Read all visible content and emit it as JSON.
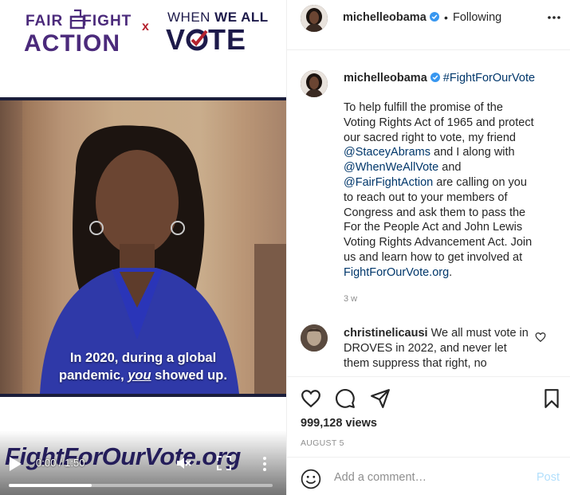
{
  "media": {
    "brand_left_line1": "FAIR",
    "brand_left_line1b": "FIGHT",
    "brand_left_line2": "ACTION",
    "brand_x": "x",
    "brand_right_line1_a": "WHEN ",
    "brand_right_line1_b": "WE ALL",
    "brand_right_line2_a": "V",
    "brand_right_line2_b": "TE",
    "subtitle_line1": "In 2020, during a global",
    "subtitle_line2_a": "pandemic, ",
    "subtitle_line2_b": "you",
    "subtitle_line2_c": " showed up.",
    "banner": "FightForOurVote.org",
    "time": "0:00 / 1:50",
    "progress": 0.315,
    "icons": [
      "play-icon",
      "mute-icon",
      "fullscreen-icon",
      "more-vertical-icon"
    ]
  },
  "header": {
    "username": "michelleobama",
    "dot": "•",
    "following": "Following"
  },
  "caption": {
    "username": "michelleobama",
    "hashtag": "#FightForOurVote",
    "lines": [
      "To help fulfill the promise of the",
      "Voting Rights Act of 1965 and protect",
      "our sacred right to vote, my friend"
    ],
    "mention1": "@StaceyAbrams",
    "after_mention1": " and I along with",
    "mention2": "@WhenWeAllVote",
    "after_mention2": " and",
    "mention3": "@FairFightAction",
    "after_mention3": " are calling on you",
    "rest": [
      "to reach out to your members of",
      "Congress and ask them to pass the",
      "For the People Act and John Lewis",
      "Voting Rights Advancement Act. Join",
      "us and learn how to get involved at"
    ],
    "link": "FightForOurVote.org",
    "link_suffix": ".",
    "time": "3 w"
  },
  "comment": {
    "username": "christinelicausi",
    "text": " We all must vote in DROVES in 2022, and never let them suppress that right, no"
  },
  "actions": {
    "views": "999,128 views",
    "date": "AUGUST 5"
  },
  "comment_box": {
    "placeholder": "Add a comment…",
    "post_label": "Post"
  },
  "colors": {
    "link": "#00376b",
    "verified": "#3897f0",
    "post_disabled": "#b2dffc",
    "brand_purple": "#4b2a7b",
    "brand_navy": "#1d1a4a",
    "brand_red": "#b5232f"
  }
}
